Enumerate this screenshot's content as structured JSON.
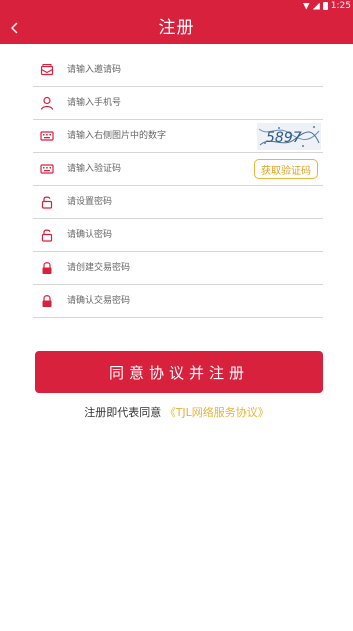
{
  "status_bar": {
    "time": "1:25"
  },
  "header": {
    "title": "注册"
  },
  "form": {
    "fields": [
      {
        "placeholder": "请输入邀请码",
        "icon": "envelope-icon"
      },
      {
        "placeholder": "请输入手机号",
        "icon": "person-icon"
      },
      {
        "placeholder": "请输入右侧图片中的数字",
        "icon": "keyboard-icon"
      },
      {
        "placeholder": "请输入验证码",
        "icon": "keyboard-icon"
      },
      {
        "placeholder": "请设置密码",
        "icon": "unlock-icon"
      },
      {
        "placeholder": "请确认密码",
        "icon": "unlock-icon"
      },
      {
        "placeholder": "请创建交易密码",
        "icon": "lock-icon"
      },
      {
        "placeholder": "请确认交易密码",
        "icon": "lock-icon"
      }
    ],
    "captcha_text": "5897",
    "get_code_label": "获取验证码"
  },
  "submit_label": "同意协议并注册",
  "agreement": {
    "prefix": "注册即代表同意",
    "link_text": "《TJL网络服务协议》"
  },
  "colors": {
    "brand": "#d7213d",
    "accent": "#e3b536"
  }
}
